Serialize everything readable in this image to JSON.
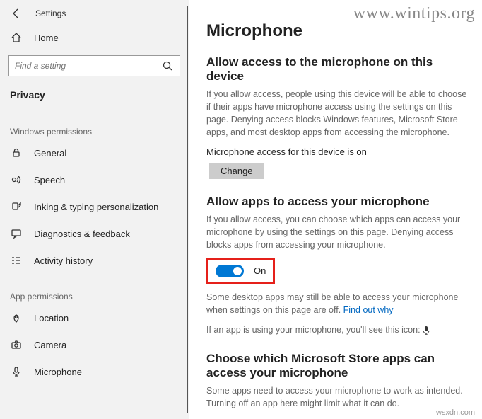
{
  "window": {
    "title": "Settings"
  },
  "watermark": "www.wintips.org",
  "footer": "wsxdn.com",
  "sidebar": {
    "home": "Home",
    "search_placeholder": "Find a setting",
    "active": "Privacy",
    "section_windows": "Windows permissions",
    "section_app": "App permissions",
    "items": {
      "general": "General",
      "speech": "Speech",
      "inking": "Inking & typing personalization",
      "diagnostics": "Diagnostics & feedback",
      "activity": "Activity history",
      "location": "Location",
      "camera": "Camera",
      "microphone": "Microphone"
    }
  },
  "main": {
    "title": "Microphone",
    "block1": {
      "heading": "Allow access to the microphone on this device",
      "desc": "If you allow access, people using this device will be able to choose if their apps have microphone access using the settings on this page. Denying access blocks Windows features, Microsoft Store apps, and most desktop apps from accessing the microphone.",
      "status": "Microphone access for this device is on",
      "change": "Change"
    },
    "block2": {
      "heading": "Allow apps to access your microphone",
      "desc": "If you allow access, you can choose which apps can access your microphone by using the settings on this page. Denying access blocks apps from accessing your microphone.",
      "toggle_label": "On",
      "note1a": "Some desktop apps may still be able to access your microphone when settings on this page are off. ",
      "note1_link": "Find out why",
      "note2": "If an app is using your microphone, you'll see this icon:"
    },
    "block3": {
      "heading": "Choose which Microsoft Store apps can access your microphone",
      "desc": "Some apps need to access your microphone to work as intended. Turning off an app here might limit what it can do."
    }
  }
}
